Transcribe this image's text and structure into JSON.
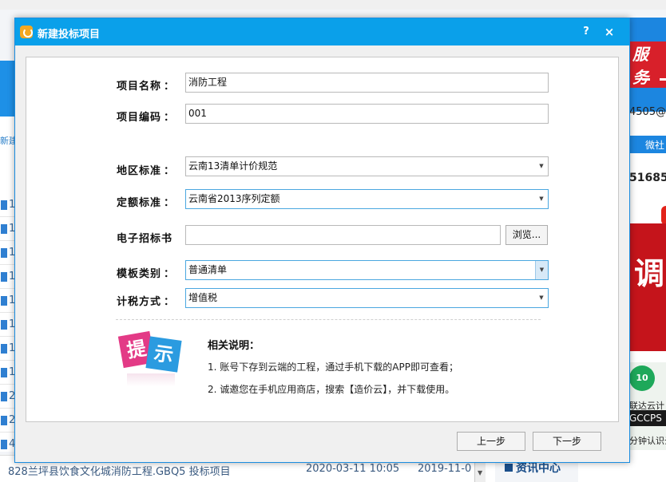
{
  "background": {
    "left_new_label": "新建",
    "left_row_numbers": [
      "1",
      "1",
      "1",
      "1",
      "1",
      "1",
      "1",
      "1",
      "2",
      "2",
      "4"
    ],
    "bottom_row": {
      "filename": "828兰坪县饮食文化城消防工程.GBQ5   投标项目",
      "date1": "2020-03-11 10:05",
      "date2": "2019-11-0"
    },
    "right_panel": {
      "ad_text": "服务",
      "email_fragment": "4505@",
      "tab_label": "微社",
      "phone_fragment": "51685",
      "red_banner_char": "调",
      "badge_text": "10",
      "promo_text": "联达云计",
      "gccps_text": "GCCPS",
      "promo_text2": "分钟认识云",
      "news_title": "资讯中心"
    },
    "colors": {
      "titlebar": "#0aa0ea",
      "accent_blue": "#1c86e0",
      "red": "#c5141b"
    }
  },
  "dialog": {
    "title": "新建投标项目",
    "help_label": "?",
    "close_label": "×",
    "fields": {
      "project_name": {
        "label": "项目名称",
        "value": "消防工程"
      },
      "project_code": {
        "label": "项目编码",
        "value": "001"
      },
      "region_standard": {
        "label": "地区标准",
        "value": "云南13清单计价规范"
      },
      "quota_standard": {
        "label": "定额标准",
        "value": "云南省2013序列定额"
      },
      "tender_file": {
        "label": "电子招标书",
        "value": "",
        "browse_label": "浏览..."
      },
      "template_type": {
        "label": "模板类别",
        "value": "普通清单"
      },
      "tax_method": {
        "label": "计税方式",
        "value": "增值税"
      }
    },
    "colon": "：",
    "tip": {
      "art_chars": [
        "提",
        "示"
      ],
      "title": "相关说明：",
      "lines": [
        "1.  账号下存到云端的工程，通过手机下载的APP即可查看；",
        "2.  诚邀您在手机应用商店，搜索【造价云】，并下载使用。"
      ]
    },
    "buttons": {
      "prev": "上一步",
      "next": "下一步"
    }
  }
}
